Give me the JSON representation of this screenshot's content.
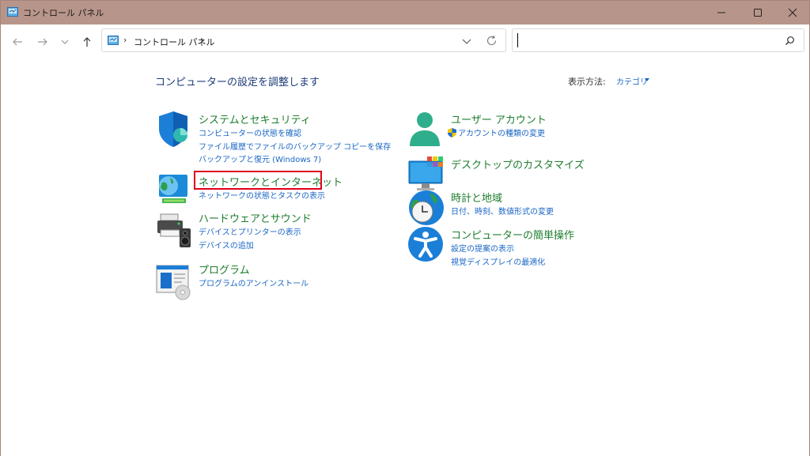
{
  "window": {
    "title": "コントロール パネル"
  },
  "address": {
    "crumb": "コントロール パネル",
    "separator": "›"
  },
  "search": {
    "placeholder": ""
  },
  "content": {
    "page_title": "コンピューターの設定を調整します",
    "view_label": "表示方法:",
    "view_value": "カテゴリ"
  },
  "categories": {
    "system": {
      "title": "システムとセキュリティ",
      "links": [
        "コンピューターの状態を確認",
        "ファイル履歴でファイルのバックアップ コピーを保存",
        "バックアップと復元 (Windows 7)"
      ]
    },
    "network": {
      "title": "ネットワークとインターネット",
      "links": [
        "ネットワークの状態とタスクの表示"
      ]
    },
    "hardware": {
      "title": "ハードウェアとサウンド",
      "links": [
        "デバイスとプリンターの表示",
        "デバイスの追加"
      ]
    },
    "programs": {
      "title": "プログラム",
      "links": [
        "プログラムのアンインストール"
      ]
    },
    "user": {
      "title": "ユーザー アカウント",
      "links": [
        "アカウントの種類の変更"
      ]
    },
    "desktop": {
      "title": "デスクトップのカスタマイズ",
      "links": []
    },
    "clock": {
      "title": "時計と地域",
      "links": [
        "日付、時刻、数値形式の変更"
      ]
    },
    "access": {
      "title": "コンピューターの簡単操作",
      "links": [
        "設定の提案の表示",
        "視覚ディスプレイの最適化"
      ]
    }
  },
  "icons": {
    "app": "control-panel-icon",
    "back": "arrow-left-icon",
    "forward": "arrow-right-icon",
    "recent": "chevron-down-icon",
    "up": "arrow-up-icon",
    "refresh": "refresh-icon",
    "search": "search-icon"
  },
  "colors": {
    "titlebar": "#b8958a",
    "category_title": "#1d7d2e",
    "link": "#1a66c4",
    "page_title": "#1e3c78",
    "highlight": "#e0001a"
  }
}
